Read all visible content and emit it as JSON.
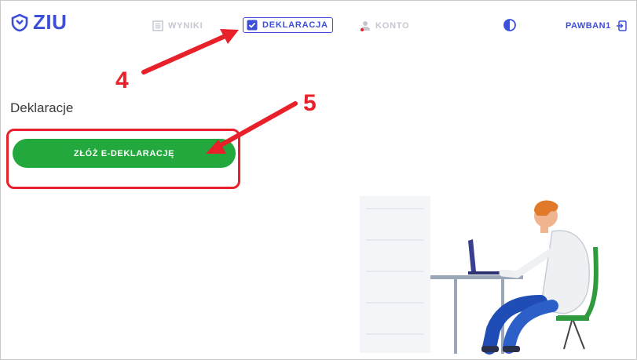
{
  "app": {
    "logo_text": "ZIU",
    "logo_icon": "shield-icon"
  },
  "nav": {
    "items": [
      {
        "label": "WYNIKI",
        "icon": "document-icon",
        "active": false
      },
      {
        "label": "DEKLARACJA",
        "icon": "checklist-icon",
        "active": true
      },
      {
        "label": "KONTO",
        "icon": "user-icon",
        "active": false
      }
    ],
    "theme_icon": "contrast-icon",
    "username": "PAWBAN1",
    "logout_icon": "logout-icon"
  },
  "main": {
    "title": "Deklaracje",
    "submit_button": "ZŁÓŻ E-DEKLARACJĘ"
  },
  "annotations": {
    "step_4": "4",
    "step_5": "5",
    "color": "#e8202a"
  },
  "colors": {
    "brand": "#3d4fd6",
    "button": "#22a83c",
    "inactive": "#c4c7cf"
  }
}
